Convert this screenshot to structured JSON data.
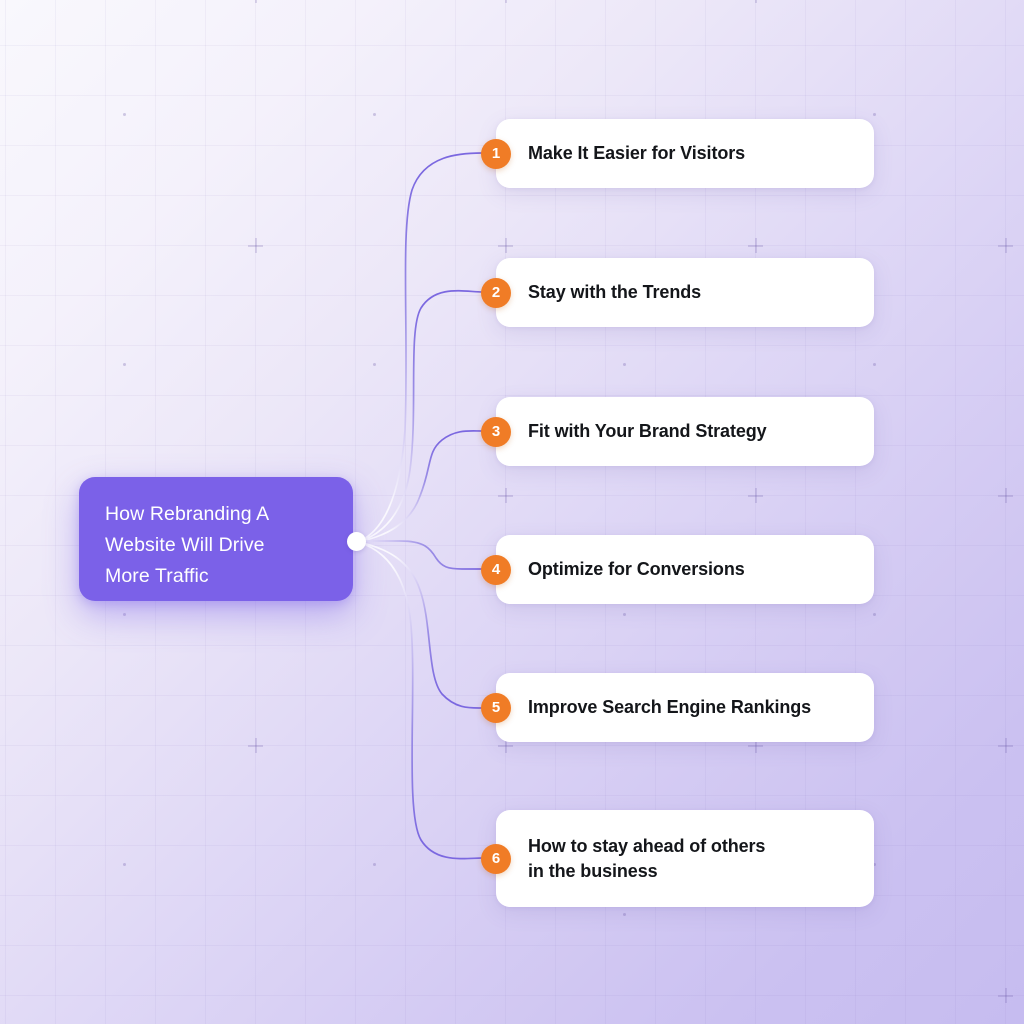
{
  "central": {
    "title": "How Rebranding A\nWebsite Will Drive\nMore Traffic",
    "color": "#7b61e8"
  },
  "theme": {
    "badge_color": "#f07c26",
    "card_color": "#ffffff",
    "connector_color": "#7b68e0",
    "background_from": "#f9f8fd",
    "background_to": "#c6bcf0",
    "text_color": "#14161a"
  },
  "branches": [
    {
      "number": "1",
      "label": "Make It Easier for Visitors"
    },
    {
      "number": "2",
      "label": "Stay with the Trends"
    },
    {
      "number": "3",
      "label": "Fit with Your Brand Strategy"
    },
    {
      "number": "4",
      "label": "Optimize for Conversions"
    },
    {
      "number": "5",
      "label": "Improve Search Engine Rankings"
    },
    {
      "number": "6",
      "label": "How to stay ahead of others\nin the business"
    }
  ]
}
